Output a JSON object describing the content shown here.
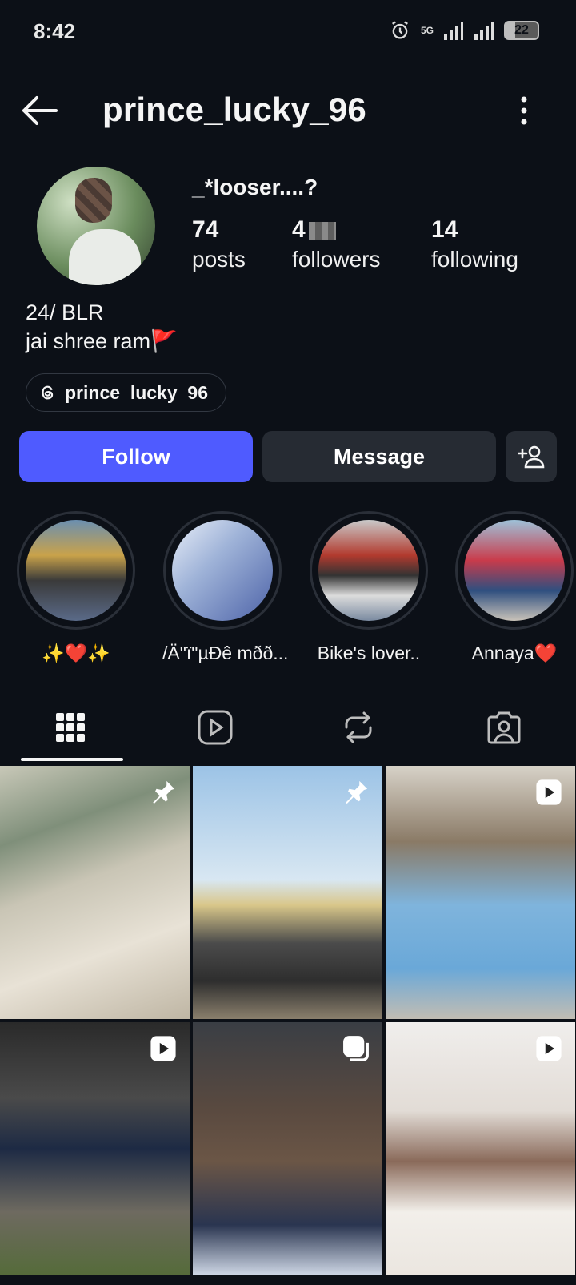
{
  "status_bar": {
    "time": "8:42",
    "network": "5G",
    "battery": "22"
  },
  "header": {
    "username": "prince_lucky_96"
  },
  "profile": {
    "display_name": "_*looser....?",
    "stats": {
      "posts": {
        "value": "74",
        "label": "posts"
      },
      "followers": {
        "value": "4",
        "label": "followers"
      },
      "following": {
        "value": "14",
        "label": "following"
      }
    },
    "bio": [
      "24/ BLR",
      "jai shree ram🚩"
    ],
    "threads_handle": "prince_lucky_96"
  },
  "actions": {
    "follow": "Follow",
    "message": "Message"
  },
  "highlights": [
    {
      "label": "✨❤️✨"
    },
    {
      "label": "/Ä\"ï\"µÐê mðð..."
    },
    {
      "label": "Bike's lover.."
    },
    {
      "label": "Annaya❤️"
    }
  ],
  "tabs": [
    "posts-grid",
    "reels",
    "reposts",
    "tagged"
  ],
  "grid_badges": [
    "pin-icon",
    "pin-icon",
    "reel-icon",
    "reel-icon",
    "carousel-icon",
    "reel-icon"
  ],
  "colors": {
    "background": "#0c1017",
    "follow_button": "#4f5bff",
    "secondary_button": "#262b33"
  }
}
